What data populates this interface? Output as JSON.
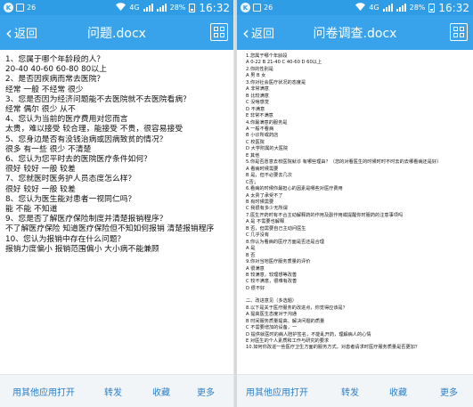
{
  "status_bar": {
    "left_icons": [
      "k-icon",
      "notification-square-icon",
      "message-icon"
    ],
    "notification_count": "26",
    "network": "4G",
    "battery": "28%",
    "time": "16:32"
  },
  "left": {
    "back_label": "返回",
    "title": "问题.docx",
    "lines": [
      "1、您属于哪个年龄段的人？",
      "20-40  40-60  60-80  80以上",
      "2、是否因疾病而常去医院？",
      "经常  一般  不经常  很少",
      "3、您是否因为经济问题能不去医院就不去医院看病？",
      "经常  偶尔  很少  从不",
      "4、您认为当前的医疗费用对您而言",
      "太贵，难以接受  较合理，能接受  不贵，很容易接受",
      "5、您身边是否有没钱治病或因病致贫的情况？",
      "很多  有一些  很少  不清楚",
      "6、您认为您平时去的医院医疗条件如何？",
      "很好  较好  一般  较差",
      "7、您就医时医务护人员态度怎么样？",
      "很好  较好  一般  较差",
      "8、您认为医生能对患者一视同仁吗？",
      "能  不能  不知道",
      "9、您是否了解医疗保险制度并清楚报销程序？",
      "不了解医疗保险  知道医疗保险但不知如何报销  清楚报销程序",
      "10、您认为报销中存在什么问题？",
      "报销力度偏小  报销范围偏小  大小病不能兼顾"
    ],
    "actions": [
      "用其他应用打开",
      "转发",
      "收藏",
      "更多"
    ]
  },
  "right": {
    "back_label": "返回",
    "title": "问卷调查.docx",
    "lines": [
      "1.您属于哪个年龄段",
      "   A 0-22   B 21-40   C 40-60   D 60以上",
      "2.你的性别是",
      "   A 男     B 女",
      "3.你对社会医疗状况的态度是",
      "   A 非常满意",
      "   B 比较满意",
      "   C 没啥感觉",
      "   D 不满意",
      "   E 非常不满意",
      "4.你最满意的服务是",
      "   A 一般不看病",
      "   B 小诊所或药店",
      "   C 校医院",
      "   D 大学附属的大医院",
      "   E 其他",
      "5.你是否愿意去校医院就诊 有哪些理由？（您的对看医生的时候时时不时去的去哪看病还是好）",
      "   A 看病时候需要",
      "   B 是，但不必要去几次",
      "   C否；",
      "6.看病的时候你最担心的因素是哪些对医疗费用",
      "   A 太贵了承受不了",
      "   B 有时候需要",
      "   C 我很有多少无所谓",
      "7.医生开药时有不合主动解释药的作用及副作用或提醒你时服药的注意事项吗",
      "   A 是 不需要也解释",
      "   B 否，但需要自己主动问医生",
      "   C 几乎没有",
      "8.你认为看病的医疗方面是否还是合理",
      "   A 是",
      "   B 否",
      "9.你对当地医疗服务质量的评价",
      "   A 很满意",
      "   B 较满意，较理想等改善",
      "   C 较不满意，很难有改善",
      "   D 很不好",
      "",
      "二、改进意见（多选题）",
      "8.以下是关于医疗服务的改进点，你觉得应该是？",
      "   A 提高医生态度对于沟通",
      "   B 时间服务质量提高、解决问题的质量",
      "   C 不需要增加的设备，一",
      "   D 提供就医时的病人陪护签名，不能乱开药，理解病人的心情",
      "   E 对医生的个人素质和工作与研究的要求",
      "10.如何你改进一些医疗卫生方面的服务方式，对患者请求时医疗服务质量是否更加？"
    ],
    "actions": [
      "用其他应用打开",
      "转发",
      "收藏",
      "更多"
    ]
  },
  "colors": {
    "status_bar": "#2f9de6",
    "title_bar": "#38a3ea",
    "bottom_bar": "#f2f5f8",
    "action_text": "#2b7fc8"
  }
}
